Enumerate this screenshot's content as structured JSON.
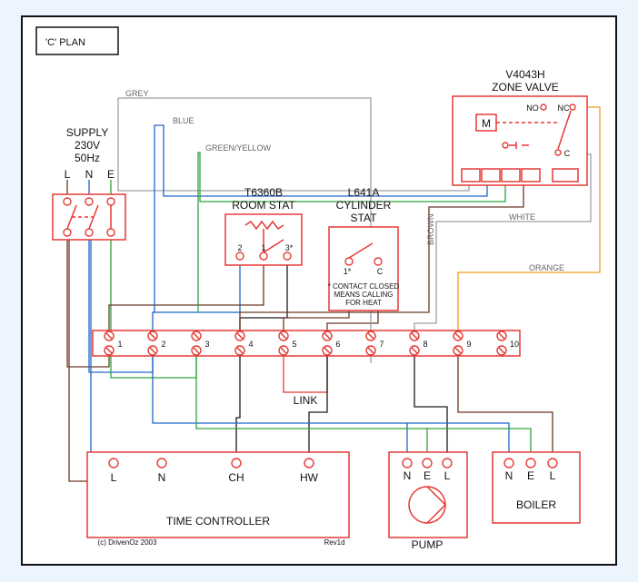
{
  "title": "'C' PLAN",
  "supply": {
    "label": "SUPPLY",
    "voltage": "230V",
    "freq": "50Hz",
    "L": "L",
    "N": "N",
    "E": "E"
  },
  "roomstat": {
    "model": "T6360B",
    "label": "ROOM STAT",
    "t2": "2",
    "t1": "1",
    "t3": "3*"
  },
  "cylstat": {
    "model": "L641A",
    "label1": "CYLINDER",
    "label2": "STAT",
    "t1": "1*",
    "tc": "C",
    "note1": "* CONTACT CLOSED",
    "note2": "MEANS CALLING",
    "note3": "FOR HEAT"
  },
  "zonevalve": {
    "model": "V4043H",
    "label": "ZONE VALVE",
    "M": "M",
    "NO": "NO",
    "NC": "NC",
    "C": "C"
  },
  "link": "LINK",
  "junction": {
    "t1": "1",
    "t2": "2",
    "t3": "3",
    "t4": "4",
    "t5": "5",
    "t6": "6",
    "t7": "7",
    "t8": "8",
    "t9": "9",
    "t10": "10"
  },
  "timecontroller": {
    "label": "TIME CONTROLLER",
    "L": "L",
    "N": "N",
    "CH": "CH",
    "HW": "HW"
  },
  "pump": {
    "label": "PUMP",
    "N": "N",
    "E": "E",
    "L": "L"
  },
  "boiler": {
    "label": "BOILER",
    "N": "N",
    "E": "E",
    "L": "L"
  },
  "wirelabels": {
    "grey": "GREY",
    "blue": "BLUE",
    "greenyellow": "GREEN/YELLOW",
    "brown": "BROWN",
    "white": "WHITE",
    "orange": "ORANGE"
  },
  "credits": {
    "copyright": "(c) DrivenOz 2003",
    "rev": "Rev1d"
  }
}
